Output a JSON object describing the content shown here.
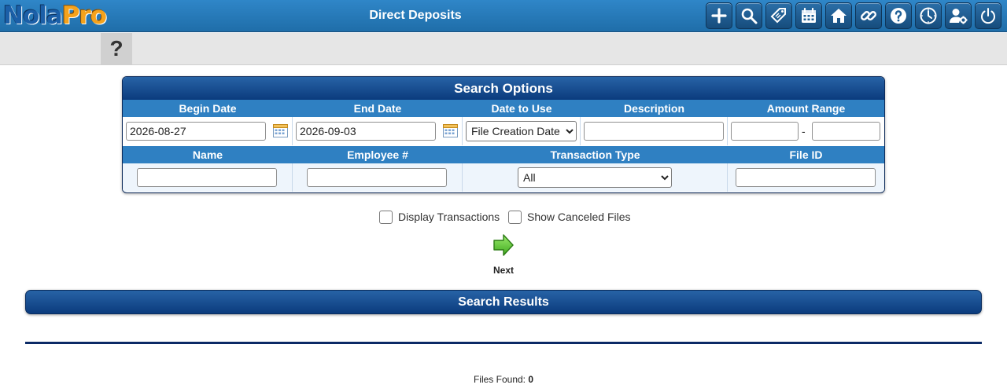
{
  "app": {
    "logo_part1": "Nola",
    "logo_part2": "Pro",
    "title": "Direct Deposits"
  },
  "toolbar": {
    "icons": [
      "add-icon",
      "search-icon",
      "price-tag-icon",
      "calendar-icon",
      "home-icon",
      "link-icon",
      "help-icon",
      "clock-icon",
      "user-settings-icon",
      "power-icon"
    ]
  },
  "subbar": {
    "help_label": "?"
  },
  "search_options": {
    "title": "Search Options",
    "headers_row1": {
      "begin_date": "Begin Date",
      "end_date": "End Date",
      "date_to_use": "Date to Use",
      "description": "Description",
      "amount_range": "Amount Range"
    },
    "headers_row2": {
      "name": "Name",
      "employee_no": "Employee #",
      "transaction_type": "Transaction Type",
      "file_id": "File ID"
    },
    "fields": {
      "begin_date_value": "2026-08-27",
      "end_date_value": "2026-09-03",
      "date_to_use_selected": "File Creation Date",
      "description_value": "",
      "amount_min": "",
      "amount_separator": "-",
      "amount_max": "",
      "name_value": "",
      "employee_no_value": "",
      "transaction_type_selected": "All",
      "file_id_value": ""
    }
  },
  "options": {
    "display_transactions_label": "Display Transactions",
    "display_transactions_checked": false,
    "show_canceled_label": "Show Canceled Files",
    "show_canceled_checked": false
  },
  "next": {
    "label": "Next"
  },
  "results": {
    "title": "Search Results",
    "files_found_label": "Files Found:",
    "files_found_count": "0"
  },
  "colors": {
    "header_blue": "#1f6ea9",
    "panel_navy": "#0b3b7d",
    "column_header_blue": "#2f80c2",
    "logo_orange": "#f4a21c",
    "next_green": "#5ccf3a"
  }
}
